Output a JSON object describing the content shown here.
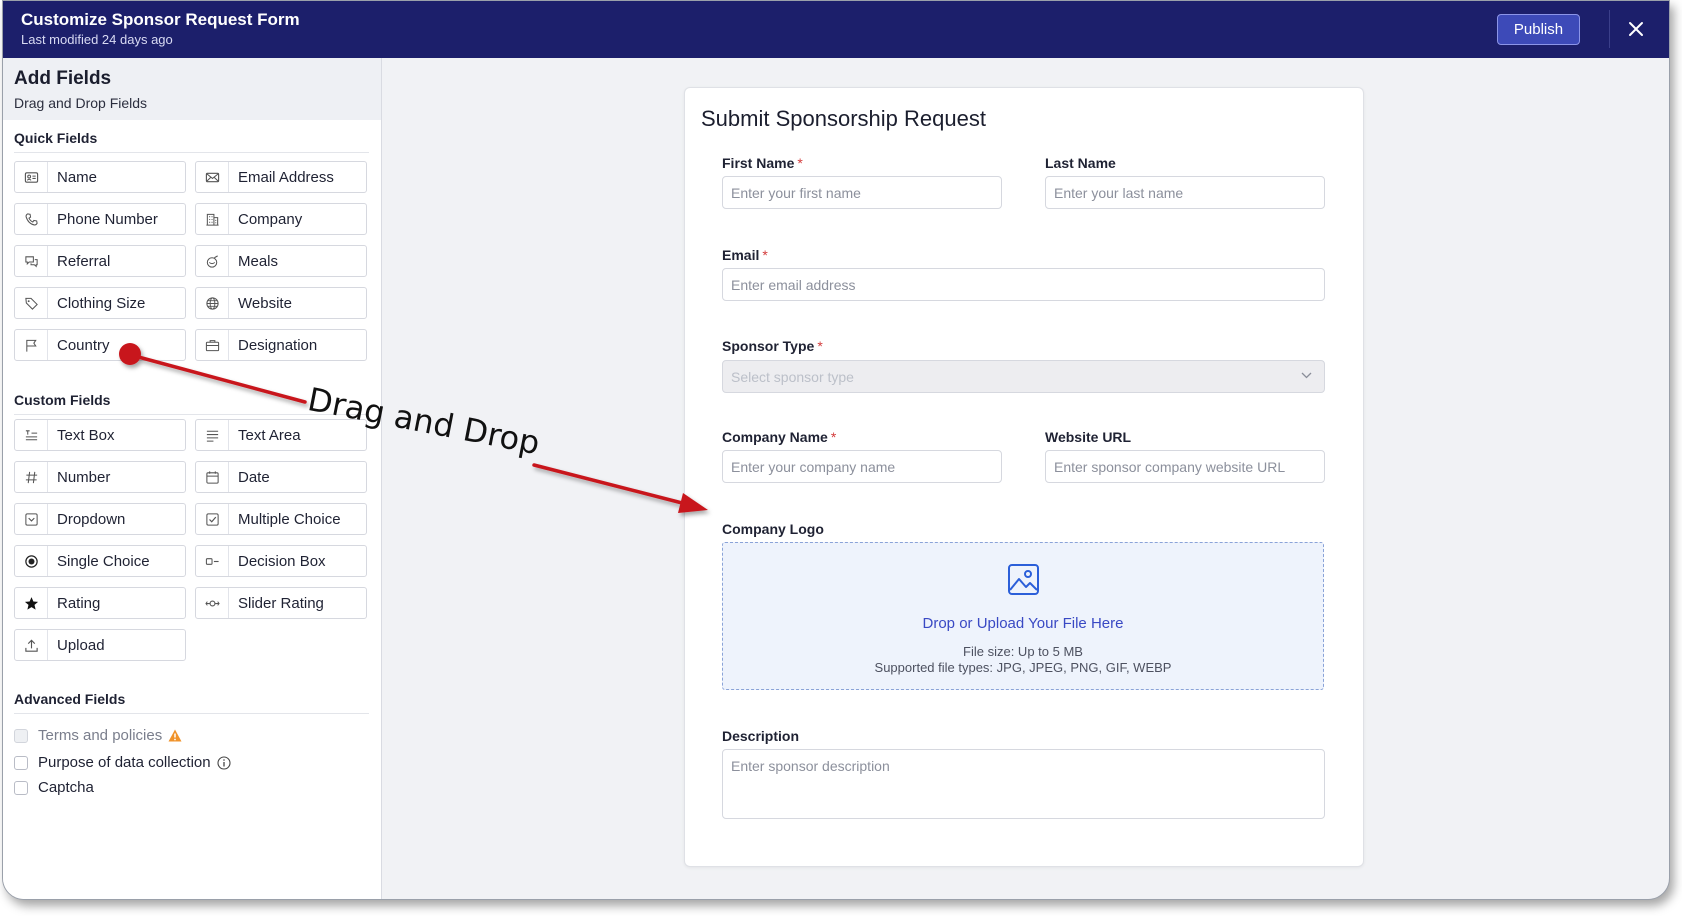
{
  "header": {
    "title": "Customize Sponsor Request Form",
    "subtitle": "Last modified 24 days ago",
    "publish_label": "Publish",
    "accent": "#1c1f6b"
  },
  "sidebar": {
    "title": "Add Fields",
    "subtitle": "Drag and Drop Fields",
    "quick_title": "Quick Fields",
    "quick": [
      {
        "label": "Name",
        "icon": "id-card-icon"
      },
      {
        "label": "Email Address",
        "icon": "envelope-icon"
      },
      {
        "label": "Phone Number",
        "icon": "phone-icon"
      },
      {
        "label": "Company",
        "icon": "building-icon"
      },
      {
        "label": "Referral",
        "icon": "chat-bubbles-icon"
      },
      {
        "label": "Meals",
        "icon": "bowl-icon"
      },
      {
        "label": "Clothing Size",
        "icon": "tag-icon"
      },
      {
        "label": "Website",
        "icon": "globe-icon"
      },
      {
        "label": "Country",
        "icon": "flag-icon"
      },
      {
        "label": "Designation",
        "icon": "briefcase-icon"
      }
    ],
    "custom_title": "Custom Fields",
    "custom": [
      {
        "label": "Text Box",
        "icon": "text-lines-icon"
      },
      {
        "label": "Text Area",
        "icon": "paragraph-icon"
      },
      {
        "label": "Number",
        "icon": "hash-icon"
      },
      {
        "label": "Date",
        "icon": "calendar-icon"
      },
      {
        "label": "Dropdown",
        "icon": "dropdown-icon"
      },
      {
        "label": "Multiple Choice",
        "icon": "checkbox-icon"
      },
      {
        "label": "Single Choice",
        "icon": "radio-icon"
      },
      {
        "label": "Decision Box",
        "icon": "toggle-icon"
      },
      {
        "label": "Rating",
        "icon": "star-icon"
      },
      {
        "label": "Slider Rating",
        "icon": "slider-icon"
      },
      {
        "label": "Upload",
        "icon": "upload-icon"
      }
    ],
    "advanced_title": "Advanced Fields",
    "advanced": [
      {
        "label": "Terms and policies"
      },
      {
        "label": "Purpose of data collection"
      },
      {
        "label": "Captcha"
      }
    ]
  },
  "form": {
    "title": "Submit Sponsorship Request",
    "first_name": {
      "label": "First Name",
      "placeholder": "Enter your first name"
    },
    "last_name": {
      "label": "Last Name",
      "placeholder": "Enter your last name"
    },
    "email": {
      "label": "Email",
      "placeholder": "Enter email address"
    },
    "sponsor_type": {
      "label": "Sponsor Type",
      "placeholder": "Select sponsor type"
    },
    "company_name": {
      "label": "Company Name",
      "placeholder": "Enter your company name"
    },
    "website_url": {
      "label": "Website URL",
      "placeholder": "Enter sponsor company website URL"
    },
    "logo": {
      "label": "Company Logo",
      "upload_text": "Drop or Upload Your File Here",
      "file_size": "File size: Up to 5 MB",
      "file_types": "Supported file types: JPG, JPEG, PNG, GIF, WEBP"
    },
    "description": {
      "label": "Description",
      "placeholder": "Enter sponsor description"
    },
    "required_mark": "*"
  },
  "annotation": {
    "text": "Drag and Drop",
    "color": "#c8161d"
  }
}
